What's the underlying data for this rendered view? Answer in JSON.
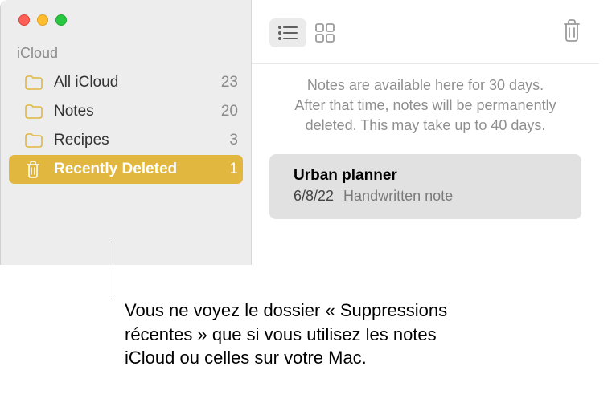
{
  "sidebar": {
    "sectionLabel": "iCloud",
    "items": [
      {
        "label": "All iCloud",
        "count": "23"
      },
      {
        "label": "Notes",
        "count": "20"
      },
      {
        "label": "Recipes",
        "count": "3"
      },
      {
        "label": "Recently Deleted",
        "count": "1"
      }
    ]
  },
  "info": {
    "line1": "Notes are available here for 30 days.",
    "line2": "After that time, notes will be permanently",
    "line3": "deleted. This may take up to 40 days."
  },
  "note": {
    "title": "Urban planner",
    "date": "6/8/22",
    "subtitle": "Handwritten note"
  },
  "callout": "Vous ne voyez le dossier « Suppressions récentes » que si vous utilisez les notes iCloud ou celles sur votre Mac."
}
